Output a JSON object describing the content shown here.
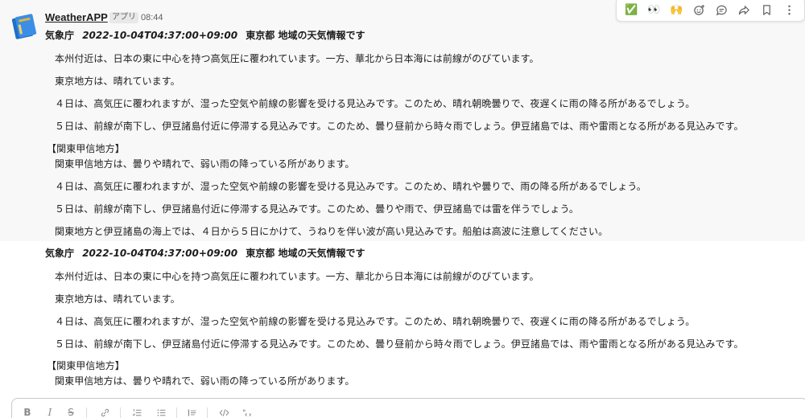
{
  "sender": {
    "name": "WeatherAPP",
    "badge": "アプリ",
    "time": "08:44"
  },
  "message1": {
    "agency": "気象庁",
    "timestamp": "2022-10-04T04:37:00+09:00",
    "title": "東京都 地域の天気情報です",
    "lines": [
      "本州付近は、日本の東に中心を持つ高気圧に覆われています。一方、華北から日本海には前線がのびています。",
      "東京地方は、晴れています。",
      "４日は、高気圧に覆われますが、湿った空気や前線の影響を受ける見込みです。このため、晴れ朝晩曇りで、夜遅くに雨の降る所があるでしょう。",
      "５日は、前線が南下し、伊豆諸島付近に停滞する見込みです。このため、曇り昼前から時々雨でしょう。伊豆諸島では、雨や雷雨となる所がある見込みです。",
      "【関東甲信地方】",
      "関東甲信地方は、曇りや晴れで、弱い雨の降っている所があります。",
      "４日は、高気圧に覆われますが、湿った空気や前線の影響を受ける見込みです。このため、晴れや曇りで、雨の降る所があるでしょう。",
      "５日は、前線が南下し、伊豆諸島付近に停滞する見込みです。このため、曇りや雨で、伊豆諸島では雷を伴うでしょう。",
      "関東地方と伊豆諸島の海上では、４日から５日にかけて、うねりを伴い波が高い見込みです。船舶は高波に注意してください。"
    ]
  },
  "message2": {
    "agency": "気象庁",
    "timestamp": "2022-10-04T04:37:00+09:00",
    "title": "東京都 地域の天気情報です",
    "lines": [
      "本州付近は、日本の東に中心を持つ高気圧に覆われています。一方、華北から日本海には前線がのびています。",
      "東京地方は、晴れています。",
      "４日は、高気圧に覆われますが、湿った空気や前線の影響を受ける見込みです。このため、晴れ朝晩曇りで、夜遅くに雨の降る所があるでしょう。",
      "５日は、前線が南下し、伊豆諸島付近に停滞する見込みです。このため、曇り昼前から時々雨でしょう。伊豆諸島では、雨や雷雨となる所がある見込みです。",
      "【関東甲信地方】",
      "関東甲信地方は、曇りや晴れで、弱い雨の降っている所があります。"
    ]
  },
  "toolbar": {
    "icons": [
      "check-reaction-icon",
      "eyes-reaction-icon",
      "raised-hands-reaction-icon",
      "add-reaction-icon",
      "reply-thread-icon",
      "share-icon",
      "bookmark-icon",
      "more-actions-icon"
    ],
    "reactions": {
      "check": "✅",
      "eyes": "👀",
      "hands": "🙌"
    }
  },
  "composer": {
    "bold": "B",
    "italic": "I",
    "strike": "S"
  },
  "colors": {
    "hover_bg": "#f8f8f8",
    "text": "#1d1c1d",
    "muted": "#616061"
  }
}
